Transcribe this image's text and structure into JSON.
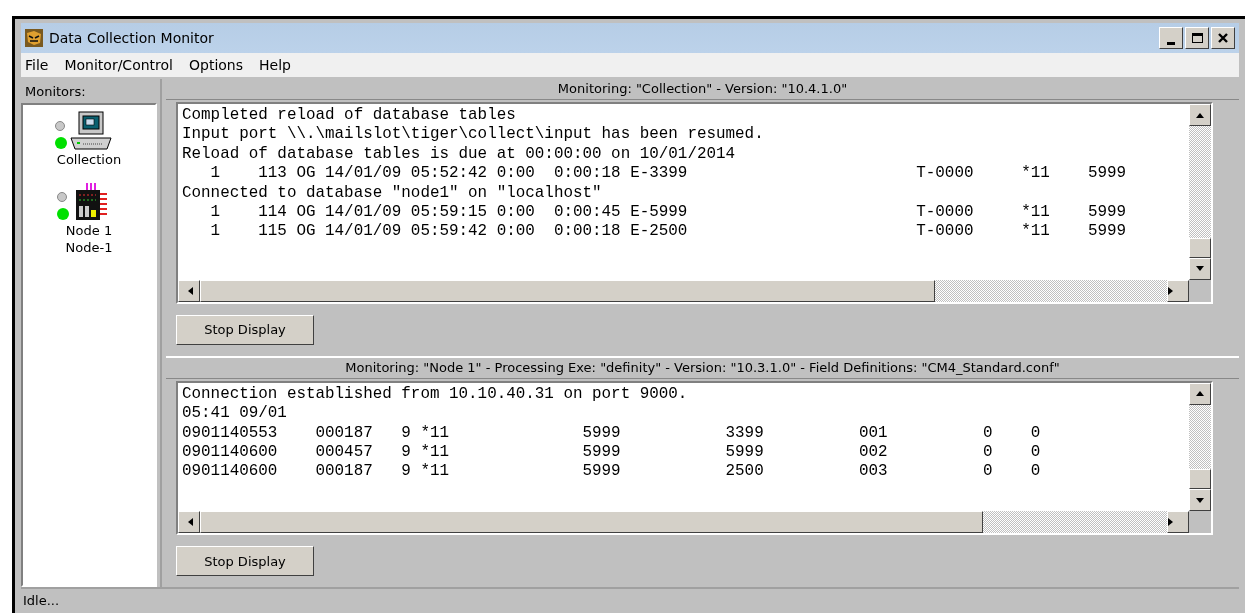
{
  "window": {
    "title": "Data Collection Monitor"
  },
  "menu": [
    "File",
    "Monitor/Control",
    "Options",
    "Help"
  ],
  "monitors": {
    "label": "Monitors:",
    "items": [
      {
        "kind": "computer",
        "name_lines": [
          "Collection"
        ],
        "running": true
      },
      {
        "kind": "node",
        "name_lines": [
          "Node 1",
          "Node-1"
        ],
        "running": true
      }
    ]
  },
  "panes": [
    {
      "header": "Monitoring: \"Collection\" - Version: \"10.4.1.0\"",
      "lines": [
        "Completed reload of database tables",
        "Input port \\\\.\\mailslot\\tiger\\collect\\input has been resumed.",
        "Reload of database tables is due at 00:00:00 on 10/01/2014",
        "   1    113 OG 14/01/09 05:52:42 0:00  0:00:18 E-3399                        T-0000     *11    5999",
        "Connected to database \"node1\" on \"localhost\"",
        "   1    114 OG 14/01/09 05:59:15 0:00  0:00:45 E-5999                        T-0000     *11    5999",
        "   1    115 OG 14/01/09 05:59:42 0:00  0:00:18 E-2500                        T-0000     *11    5999"
      ],
      "button": "Stop Display"
    },
    {
      "header": "Monitoring: \"Node 1\" - Processing Exe: \"definity\" - Version: \"10.3.1.0\" - Field Definitions: \"CM4_Standard.conf\"",
      "lines": [
        "Connection established from 10.10.40.31 on port 9000.",
        "05:41 09/01",
        "0901140553    000187   9 *11              5999           3399          001          0    0",
        "0901140600    000457   9 *11              5999           5999          002          0    0",
        "0901140600    000187   9 *11              5999           2500          003          0    0"
      ],
      "button": "Stop Display"
    }
  ],
  "status_bar": "Idle..."
}
